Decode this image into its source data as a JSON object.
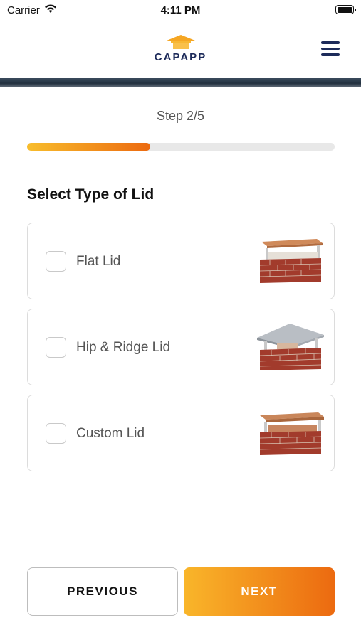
{
  "status_bar": {
    "carrier": "Carrier",
    "time": "4:11 PM"
  },
  "header": {
    "brand": "CAPAPP"
  },
  "step": {
    "label": "Step 2/5",
    "progress": 0.4
  },
  "section": {
    "title": "Select Type of Lid"
  },
  "options": [
    {
      "label": "Flat Lid",
      "checked": false,
      "icon": "flat-lid-image"
    },
    {
      "label": "Hip & Ridge Lid",
      "checked": false,
      "icon": "hip-ridge-lid-image"
    },
    {
      "label": "Custom Lid",
      "checked": false,
      "icon": "custom-lid-image"
    }
  ],
  "buttons": {
    "previous": "PREVIOUS",
    "next": "NEXT"
  },
  "colors": {
    "brand_navy": "#1d2b5a",
    "accent_start": "#f9b62a",
    "accent_end": "#ec6a10"
  }
}
